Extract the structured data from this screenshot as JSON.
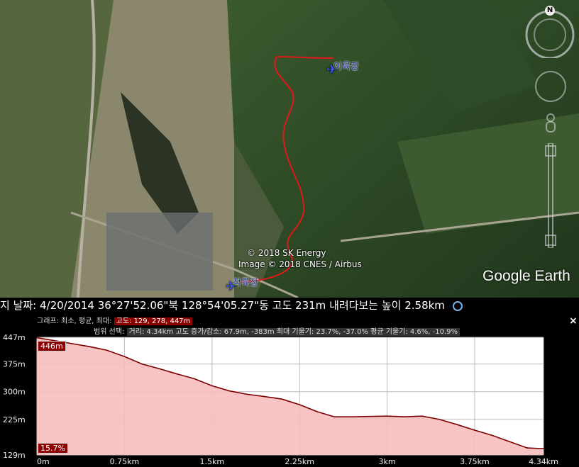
{
  "map": {
    "label_landing": "착륙장",
    "label_takeoff": "이륙장",
    "copyright_1": "© 2018 SK Energy",
    "copyright_2": "Image © 2018 CNES / Airbus",
    "logo": "Google Earth",
    "compass_letter": "N"
  },
  "statusbar": {
    "date": "지 날짜: 4/20/2014",
    "coords": "36°27'52.06\"북 128°54'05.27\"동",
    "elevation": "고도   231m",
    "eye_alt": "내려다보는 높이   2.58km"
  },
  "profile": {
    "graph_label": "그래프: 최소, 평균, 최대:",
    "graph_values": "고도: 129, 278, 447m",
    "range_label": "범위 선택:",
    "range_values": "거리: 4.34km 고도 증가/감소: 67.9m, -383m 최대 기울기: 23.7%, -37.0% 평균 기울기: 4.6%, -10.9%",
    "y_ticks": [
      "447m",
      "375m",
      "300m",
      "225m",
      "129m"
    ],
    "x_ticks": [
      "0m",
      "0.75km",
      "1.5km",
      "2.25km",
      "3km",
      "3.75km",
      "4.34km"
    ],
    "cursor_elev": "446m",
    "cursor_grade": "15.7%",
    "close": "×"
  },
  "chart_data": {
    "type": "area",
    "title": "",
    "xlabel": "",
    "ylabel": "",
    "x_unit": "km",
    "ylim": [
      129,
      447
    ],
    "xlim": [
      0,
      4.34
    ],
    "x": [
      0,
      0.15,
      0.3,
      0.45,
      0.6,
      0.75,
      0.9,
      1.05,
      1.2,
      1.35,
      1.5,
      1.65,
      1.8,
      1.95,
      2.1,
      2.25,
      2.4,
      2.55,
      2.7,
      2.85,
      3.0,
      3.15,
      3.3,
      3.45,
      3.6,
      3.75,
      3.9,
      4.05,
      4.2,
      4.34
    ],
    "y": [
      446,
      438,
      430,
      422,
      412,
      395,
      375,
      362,
      348,
      335,
      316,
      302,
      293,
      287,
      280,
      265,
      246,
      232,
      232,
      233,
      234,
      232,
      234,
      225,
      211,
      196,
      182,
      165,
      148,
      146
    ],
    "colors": {
      "line": "#7a0000",
      "fill": "#f7bcbc"
    },
    "grid": true
  }
}
